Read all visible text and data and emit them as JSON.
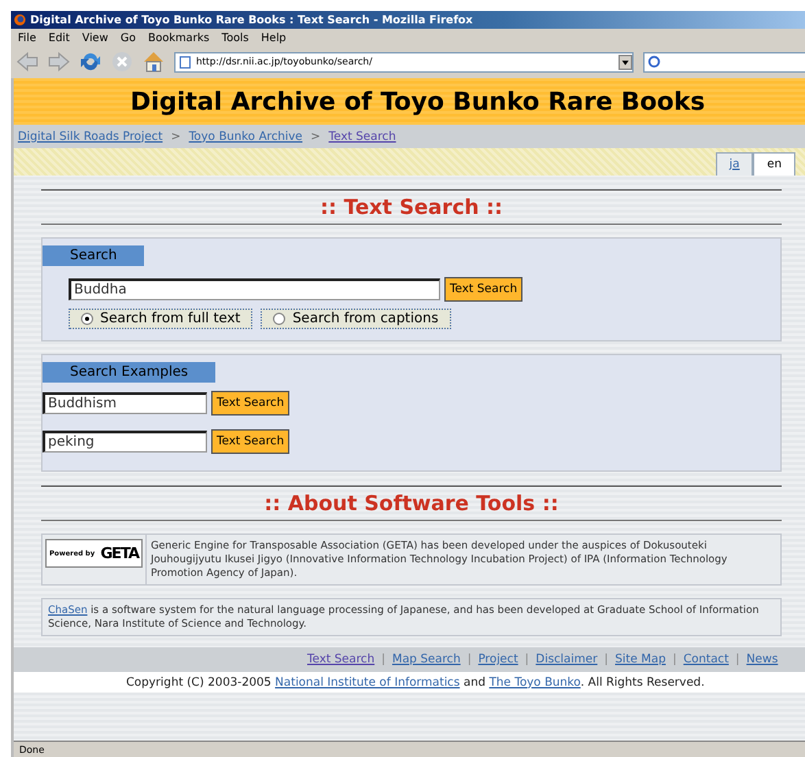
{
  "window": {
    "title": "Digital Archive of Toyo Bunko Rare Books : Text Search - Mozilla Firefox"
  },
  "menu": [
    "File",
    "Edit",
    "View",
    "Go",
    "Bookmarks",
    "Tools",
    "Help"
  ],
  "address": {
    "url": "http://dsr.nii.ac.jp/toyobunko/search/"
  },
  "header": {
    "title": "Digital Archive of Toyo Bunko Rare Books"
  },
  "breadcrumbs": [
    "Digital Silk Roads Project",
    "Toyo Bunko Archive",
    "Text Search"
  ],
  "breadcrumb_separator": ">",
  "languages": [
    {
      "label": "ja",
      "selected": false
    },
    {
      "label": "en",
      "selected": true
    }
  ],
  "section_title": ":: Text Search ::",
  "search_panel": {
    "tab": "Search",
    "query": "Buddha",
    "button": "Text Search",
    "scopes": [
      {
        "label": "Search from full text",
        "selected": true
      },
      {
        "label": "Search from captions",
        "selected": false
      }
    ]
  },
  "examples_panel": {
    "tab": "Search Examples",
    "examples": [
      {
        "value": "Buddhism",
        "button": "Text Search"
      },
      {
        "value": "peking",
        "button": "Text Search"
      }
    ]
  },
  "about_title": ":: About Software Tools ::",
  "tools": [
    {
      "kind": "logo",
      "logo_small": "Powered by",
      "logo_big": "GETA",
      "segments": [
        {
          "kind": "text",
          "text": "Generic Engine for Transposable Association (GETA) has been developed under the auspices of Dokusouteki Jouhougijyutu Ikusei Jigyo (Innovative Information Technology Incubation Project) of IPA (Information Technology Promotion Agency of Japan)."
        }
      ]
    },
    {
      "kind": "plain",
      "segments": [
        {
          "kind": "link",
          "text": "ChaSen"
        },
        {
          "kind": "text",
          "text": " is a software system for the natural language processing of Japanese, and has been developed at Graduate School of Information Science, Nara Institute of Science and Technology."
        }
      ]
    }
  ],
  "footer_links": [
    "Text Search",
    "Map Search",
    "Project",
    "Disclaimer",
    "Site Map",
    "Contact",
    "News"
  ],
  "footer_separator": "|",
  "copyright": [
    {
      "kind": "text",
      "text": "Copyright (C) 2003-2005 "
    },
    {
      "kind": "link",
      "text": "National Institute of Informatics"
    },
    {
      "kind": "text",
      "text": " and "
    },
    {
      "kind": "link",
      "text": "The Toyo Bunko"
    },
    {
      "kind": "text",
      "text": ". All Rights Reserved."
    }
  ],
  "status_bar": "Done"
}
